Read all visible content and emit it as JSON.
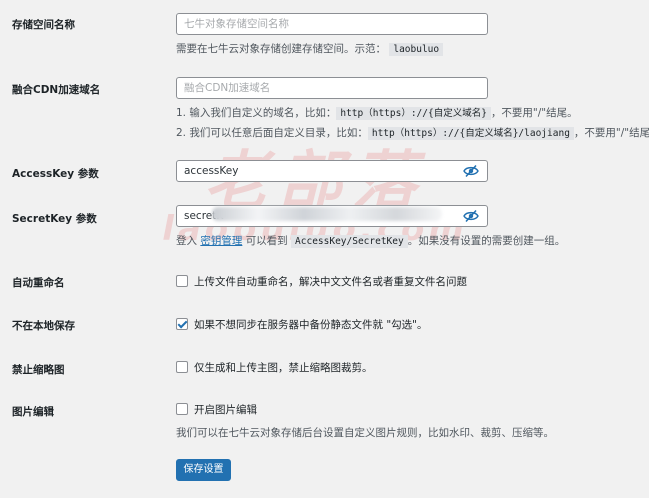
{
  "watermark": {
    "main": "老部落",
    "sub": "laobuluo.com"
  },
  "bucket": {
    "label": "存储空间名称",
    "placeholder": "七牛对象存储空间名称",
    "desc_prefix": "需要在七牛云对象存储创建存储空间。示范：",
    "desc_code": "laobuluo"
  },
  "cdn": {
    "label": "融合CDN加速域名",
    "placeholder": "融合CDN加速域名",
    "line1_prefix": "1. 输入我们自定义的域名，比如：",
    "line1_code": "http（https）://{自定义域名}",
    "line1_suffix": "，不要用\"/\"结尾。",
    "line2_prefix": "2. 我们可以任意后面自定义目录，比如：",
    "line2_code": "http（https）://{自定义域名}/laojiang",
    "line2_suffix": "，不要用\"/\"结尾。"
  },
  "accesskey": {
    "label": "AccessKey 参数",
    "value": "accessKey"
  },
  "secretkey": {
    "label": "SecretKey 参数",
    "value": "secretK",
    "desc_prefix": "登入",
    "desc_link": "密钥管理",
    "desc_mid": "可以看到",
    "desc_code": "AccessKey/SecretKey",
    "desc_suffix": "。如果没有设置的需要创建一组。"
  },
  "auto_rename": {
    "label": "自动重命名",
    "checked": false,
    "text": "上传文件自动重命名，解决中文文件名或者重复文件名问题"
  },
  "no_local": {
    "label": "不在本地保存",
    "checked": true,
    "text": "如果不想同步在服务器中备份静态文件就 \"勾选\"。"
  },
  "no_thumb": {
    "label": "禁止缩略图",
    "checked": false,
    "text": "仅生成和上传主图，禁止缩略图裁剪。"
  },
  "image_edit": {
    "label": "图片编辑",
    "checked": false,
    "text": "开启图片编辑",
    "desc": "我们可以在七牛云对象存储后台设置自定义图片规则，比如水印、裁剪、压缩等。"
  },
  "save_label": "保存设置",
  "colors": {
    "accent": "#2271b1",
    "background": "#f1f1f1"
  }
}
